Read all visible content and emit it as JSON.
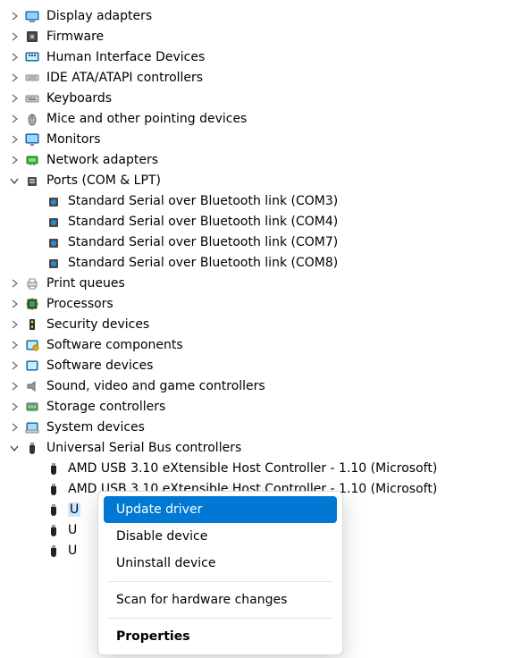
{
  "tree": [
    {
      "icon": "display",
      "label": "Display adapters",
      "indent": 0,
      "state": "collapsed"
    },
    {
      "icon": "firmware",
      "label": "Firmware",
      "indent": 0,
      "state": "collapsed"
    },
    {
      "icon": "hid",
      "label": "Human Interface Devices",
      "indent": 0,
      "state": "collapsed"
    },
    {
      "icon": "ide",
      "label": "IDE ATA/ATAPI controllers",
      "indent": 0,
      "state": "collapsed"
    },
    {
      "icon": "keyboard",
      "label": "Keyboards",
      "indent": 0,
      "state": "collapsed"
    },
    {
      "icon": "mouse",
      "label": "Mice and other pointing devices",
      "indent": 0,
      "state": "collapsed"
    },
    {
      "icon": "monitor",
      "label": "Monitors",
      "indent": 0,
      "state": "collapsed"
    },
    {
      "icon": "network",
      "label": "Network adapters",
      "indent": 0,
      "state": "collapsed"
    },
    {
      "icon": "port",
      "label": "Ports (COM & LPT)",
      "indent": 0,
      "state": "expanded"
    },
    {
      "icon": "port-bt",
      "label": "Standard Serial over Bluetooth link (COM3)",
      "indent": 1,
      "state": "leaf"
    },
    {
      "icon": "port-bt",
      "label": "Standard Serial over Bluetooth link (COM4)",
      "indent": 1,
      "state": "leaf"
    },
    {
      "icon": "port-bt",
      "label": "Standard Serial over Bluetooth link (COM7)",
      "indent": 1,
      "state": "leaf"
    },
    {
      "icon": "port-bt",
      "label": "Standard Serial over Bluetooth link (COM8)",
      "indent": 1,
      "state": "leaf"
    },
    {
      "icon": "printer",
      "label": "Print queues",
      "indent": 0,
      "state": "collapsed"
    },
    {
      "icon": "cpu",
      "label": "Processors",
      "indent": 0,
      "state": "collapsed"
    },
    {
      "icon": "security",
      "label": "Security devices",
      "indent": 0,
      "state": "collapsed"
    },
    {
      "icon": "softcomp",
      "label": "Software components",
      "indent": 0,
      "state": "collapsed"
    },
    {
      "icon": "softdev",
      "label": "Software devices",
      "indent": 0,
      "state": "collapsed"
    },
    {
      "icon": "sound",
      "label": "Sound, video and game controllers",
      "indent": 0,
      "state": "collapsed"
    },
    {
      "icon": "storage",
      "label": "Storage controllers",
      "indent": 0,
      "state": "collapsed"
    },
    {
      "icon": "system",
      "label": "System devices",
      "indent": 0,
      "state": "collapsed"
    },
    {
      "icon": "usb",
      "label": "Universal Serial Bus controllers",
      "indent": 0,
      "state": "expanded"
    },
    {
      "icon": "usb-plug",
      "label": "AMD USB 3.10 eXtensible Host Controller - 1.10 (Microsoft)",
      "indent": 1,
      "state": "leaf"
    },
    {
      "icon": "usb-plug",
      "label": "AMD USB 3.10 eXtensible Host Controller - 1.10 (Microsoft)",
      "indent": 1,
      "state": "leaf"
    },
    {
      "icon": "usb-plug",
      "label": "U",
      "indent": 1,
      "state": "leaf",
      "selected": true
    },
    {
      "icon": "usb-plug",
      "label": "U",
      "indent": 1,
      "state": "leaf"
    },
    {
      "icon": "usb-plug",
      "label": "U",
      "indent": 1,
      "state": "leaf"
    }
  ],
  "context_menu": {
    "items": [
      {
        "label": "Update driver",
        "hover": true
      },
      {
        "label": "Disable device"
      },
      {
        "label": "Uninstall device"
      },
      {
        "sep": true
      },
      {
        "label": "Scan for hardware changes"
      },
      {
        "sep": true
      },
      {
        "label": "Properties",
        "bold": true
      }
    ]
  }
}
